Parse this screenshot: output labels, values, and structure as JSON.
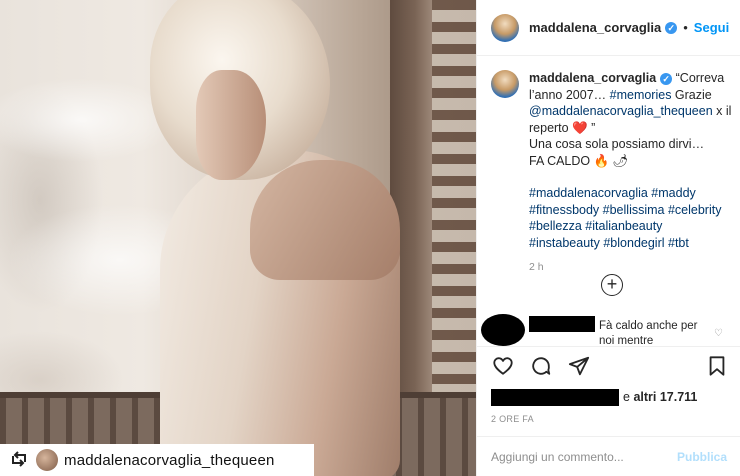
{
  "post": {
    "author": "maddalena_corvaglia",
    "follow_label": "Segui",
    "separator": "•",
    "verified_icon": "verified-badge-icon",
    "photo_description": "sepia photo"
  },
  "repost": {
    "icon": "repost-icon",
    "username": "maddalenacorvaglia_thequeen"
  },
  "caption": {
    "username": "maddalena_corvaglia",
    "line1_text": " “Correva l’anno 2007… ",
    "line1_tag": "#memories",
    "line1_after": " Grazie",
    "mention": "@maddalenacorvaglia_thequeen",
    "mention_after": " x il reperto ❤️ ”",
    "line2": "Una cosa sola possiamo dirvi…",
    "line3": "FA CALDO 🔥 🌶",
    "hashtags_line1": "#maddalenacorvaglia #maddy",
    "hashtags_line2": "#fitnessbody #bellissima #celebrity",
    "hashtags_line3": "#bellezza #italianbeauty",
    "hashtags_line4": "#instabeauty #blondegirl #tbt",
    "time": "2 h"
  },
  "load_more_icon": "plus-circle-icon",
  "comment": {
    "text": "Fà caldo anche per noi mentre guardiamo questa",
    "like_icon": "heart-icon"
  },
  "actions": {
    "like_icon": "heart-icon",
    "comment_icon": "comment-icon",
    "share_icon": "share-icon",
    "save_icon": "bookmark-icon"
  },
  "likes": {
    "prefix": "e",
    "label": "altri 17.711"
  },
  "time_ago": "2 ORE FA",
  "add_comment": {
    "placeholder": "Aggiungi un commento...",
    "publish_label": "Pubblica"
  },
  "colors": {
    "link": "#0095f6",
    "hashtag": "#00376b",
    "publish_disabled": "#b2dffc",
    "muted": "#8e8e8e"
  }
}
